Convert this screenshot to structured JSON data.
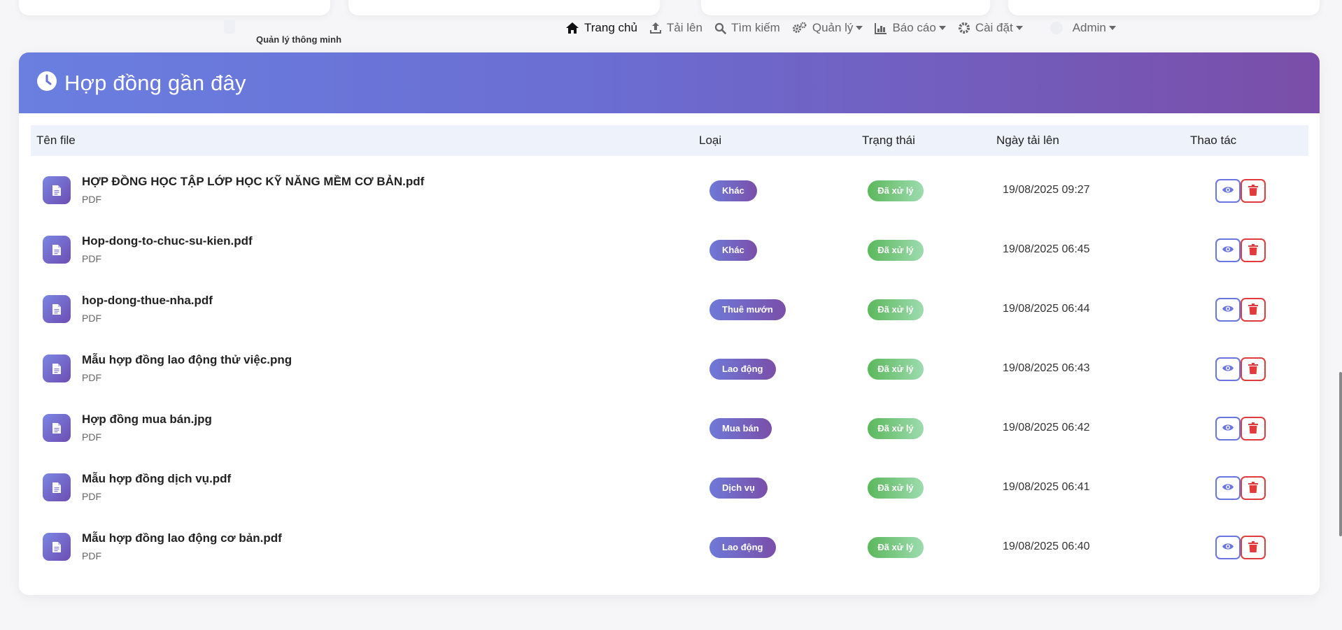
{
  "brand": {
    "subtitle": "Quản lý thông minh"
  },
  "nav": {
    "items": [
      {
        "label": "Trang chủ",
        "icon": "home-icon",
        "active": true,
        "dropdown": false
      },
      {
        "label": "Tải lên",
        "icon": "upload-icon",
        "active": false,
        "dropdown": false
      },
      {
        "label": "Tìm kiếm",
        "icon": "search-icon",
        "active": false,
        "dropdown": false
      },
      {
        "label": "Quản lý",
        "icon": "cogs-icon",
        "active": false,
        "dropdown": true
      },
      {
        "label": "Báo cáo",
        "icon": "chart-icon",
        "active": false,
        "dropdown": true
      },
      {
        "label": "Cài đặt",
        "icon": "gear-icon",
        "active": false,
        "dropdown": true
      }
    ],
    "user": {
      "label": "Admin",
      "icon": "user-avatar-icon"
    }
  },
  "panel": {
    "title": "Hợp đồng gần đây",
    "icon": "clock-icon",
    "columns": {
      "file": "Tên file",
      "type": "Loại",
      "status": "Trạng thái",
      "date": "Ngày tải lên",
      "actions": "Thao tác"
    },
    "rows": [
      {
        "name": "HỢP ĐỒNG HỌC TẬP LỚP HỌC KỸ NĂNG MỀM CƠ BẢN.pdf",
        "ext": "PDF",
        "type": "Khác",
        "status": "Đã xử lý",
        "date": "19/08/2025 09:27"
      },
      {
        "name": "Hop-dong-to-chuc-su-kien.pdf",
        "ext": "PDF",
        "type": "Khác",
        "status": "Đã xử lý",
        "date": "19/08/2025 06:45"
      },
      {
        "name": "hop-dong-thue-nha.pdf",
        "ext": "PDF",
        "type": "Thuê mướn",
        "status": "Đã xử lý",
        "date": "19/08/2025 06:44"
      },
      {
        "name": "Mẫu hợp đồng lao động thử việc.png",
        "ext": "PDF",
        "type": "Lao động",
        "status": "Đã xử lý",
        "date": "19/08/2025 06:43"
      },
      {
        "name": "Hợp đồng mua bán.jpg",
        "ext": "PDF",
        "type": "Mua bán",
        "status": "Đã xử lý",
        "date": "19/08/2025 06:42"
      },
      {
        "name": "Mẫu hợp đồng dịch vụ.pdf",
        "ext": "PDF",
        "type": "Dịch vụ",
        "status": "Đã xử lý",
        "date": "19/08/2025 06:41"
      },
      {
        "name": "Mẫu hợp đồng lao động cơ bản.pdf",
        "ext": "PDF",
        "type": "Lao động",
        "status": "Đã xử lý",
        "date": "19/08/2025 06:40"
      }
    ]
  },
  "colors": {
    "header_gradient_start": "#6a7fe0",
    "header_gradient_end": "#7a4ea8",
    "status_green": "#5cb85c",
    "view_blue": "#6a76e0",
    "delete_red": "#e23b3b"
  }
}
